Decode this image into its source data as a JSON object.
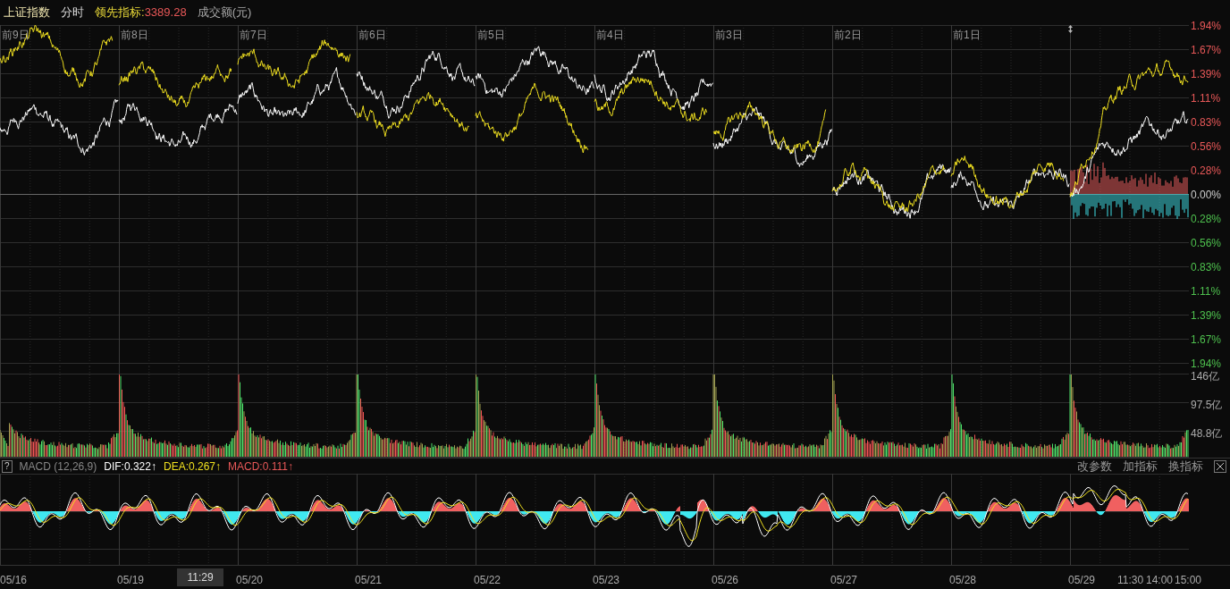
{
  "header": {
    "title": "上证指数",
    "mode": "分时",
    "indicator_label": "领先指标:",
    "indicator_value": "3389.28",
    "volume_label": "成交额(元)"
  },
  "day_labels": [
    "前9日",
    "前8日",
    "前7日",
    "前6日",
    "前5日",
    "前4日",
    "前3日",
    "前2日",
    "前1日"
  ],
  "y_axis": [
    {
      "label": "1.94%",
      "kind": "up"
    },
    {
      "label": "1.67%",
      "kind": "up"
    },
    {
      "label": "1.39%",
      "kind": "up"
    },
    {
      "label": "1.11%",
      "kind": "up"
    },
    {
      "label": "0.83%",
      "kind": "up"
    },
    {
      "label": "0.56%",
      "kind": "up"
    },
    {
      "label": "0.28%",
      "kind": "up"
    },
    {
      "label": "0.00%",
      "kind": "flat"
    },
    {
      "label": "0.28%",
      "kind": "down"
    },
    {
      "label": "0.56%",
      "kind": "down"
    },
    {
      "label": "0.83%",
      "kind": "down"
    },
    {
      "label": "1.11%",
      "kind": "down"
    },
    {
      "label": "1.39%",
      "kind": "down"
    },
    {
      "label": "1.67%",
      "kind": "down"
    },
    {
      "label": "1.94%",
      "kind": "down"
    }
  ],
  "volume_axis": [
    "146亿",
    "97.5亿",
    "48.8亿"
  ],
  "macd_header": {
    "help": "?",
    "name": "MACD (12,26,9)",
    "dif": "DIF:0.322↑",
    "dea": "DEA:0.267↑",
    "macd": "MACD:0.111↑"
  },
  "macd_buttons": [
    "改参数",
    "加指标",
    "换指标"
  ],
  "x_axis": {
    "days": [
      "05/16",
      "05/19",
      "05/20",
      "05/21",
      "05/22",
      "05/23",
      "05/26",
      "05/27",
      "05/28",
      "05/29"
    ],
    "times": [
      "11:30",
      "14:00",
      "15:00"
    ],
    "cursor_time": "11:29"
  }
}
